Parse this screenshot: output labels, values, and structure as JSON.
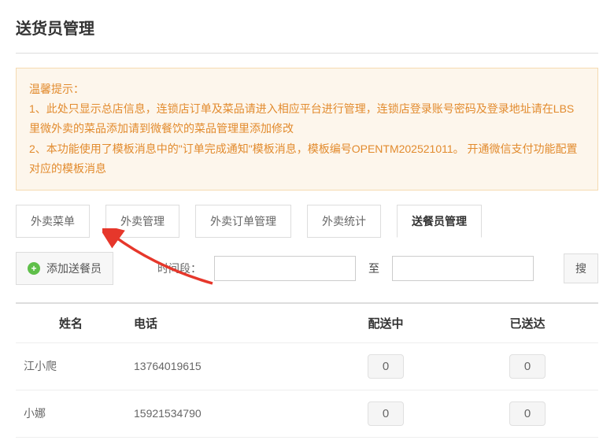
{
  "page_title": "送货员管理",
  "tip": {
    "title": "温馨提示：",
    "lines": [
      "1、此处只显示总店信息，连锁店订单及菜品请进入相应平台进行管理，连锁店登录账号密码及登录地址请在LBS里微外卖的菜品添加请到微餐饮的菜品管理里添加修改",
      "2、本功能使用了模板消息中的\"订单完成通知\"模板消息，模板编号OPENTM202521011。 开通微信支付功能配置对应的模板消息"
    ]
  },
  "tabs": [
    {
      "label": "外卖菜单",
      "active": false
    },
    {
      "label": "外卖管理",
      "active": false
    },
    {
      "label": "外卖订单管理",
      "active": false
    },
    {
      "label": "外卖统计",
      "active": false
    },
    {
      "label": "送餐员管理",
      "active": true
    }
  ],
  "toolbar": {
    "add_label": "添加送餐员",
    "time_label": "时间段：",
    "time_start": "",
    "to_sep": "至",
    "time_end": "",
    "search_label": "搜"
  },
  "table": {
    "headers": [
      "姓名",
      "电话",
      "配送中",
      "已送达"
    ],
    "rows": [
      {
        "name": "江小爬",
        "phone": "13764019615",
        "delivering": "0",
        "delivered": "0"
      },
      {
        "name": "小娜",
        "phone": "15921534790",
        "delivering": "0",
        "delivered": "0"
      }
    ]
  },
  "annotation": {
    "arrow_color": "#e6372b"
  }
}
